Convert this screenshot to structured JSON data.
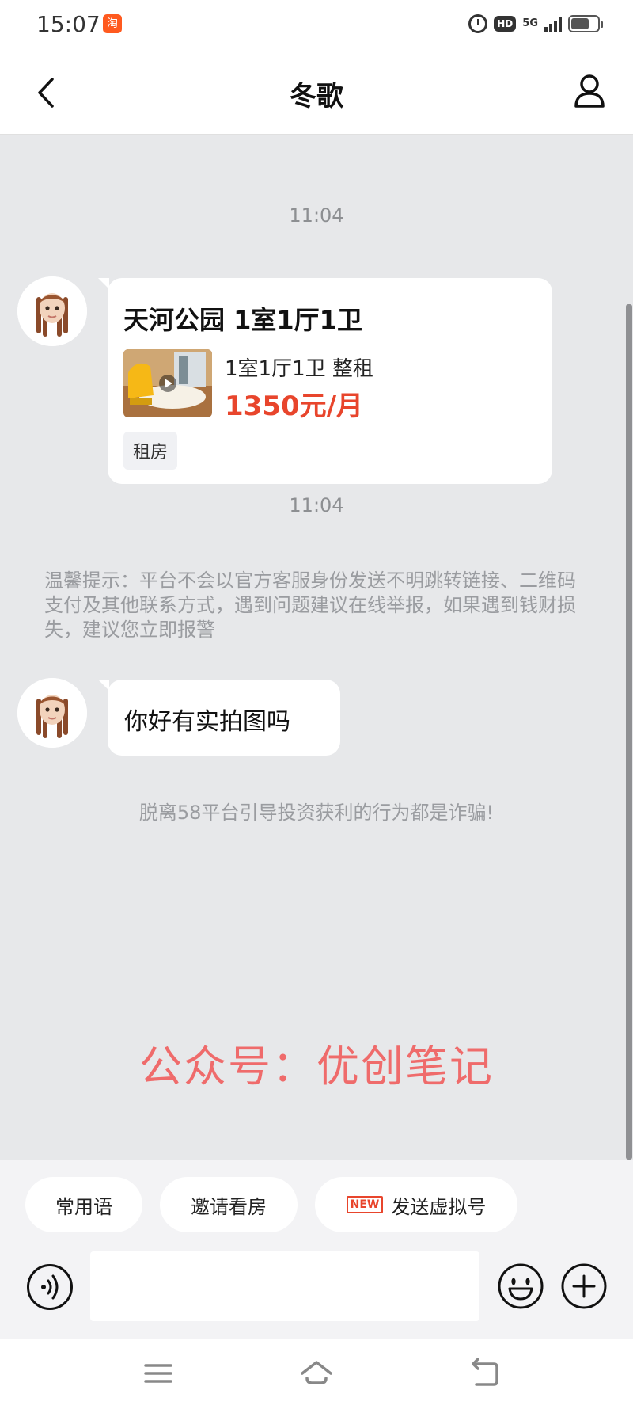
{
  "status_bar": {
    "time": "15:07",
    "app_icon": "taobao-icon",
    "hd": "HD",
    "network": "5G"
  },
  "header": {
    "title": "冬歌"
  },
  "chat": {
    "timestamps": [
      "11:04",
      "11:04"
    ],
    "listing_card": {
      "title": "天河公园 1室1厅1卫",
      "subtitle": "1室1厅1卫 整租",
      "price": "1350元/月",
      "tag": "租房"
    },
    "notice": "温馨提示：平台不会以官方客服身份发送不明跳转链接、二维码支付及其他联系方式，遇到问题建议在线举报，如果遇到钱财损失，建议您立即报警",
    "message": "你好有实拍图吗",
    "warning": "脱离58平台引导投资获利的行为都是诈骗!",
    "watermark": "公众号：优创笔记"
  },
  "quick_replies": [
    {
      "label": "常用语"
    },
    {
      "label": "邀请看房"
    },
    {
      "label": "发送虚拟号",
      "badge": "NEW"
    }
  ],
  "input": {
    "placeholder": ""
  },
  "colors": {
    "price": "#e8452c",
    "watermark": "#ef6b6b",
    "chat_background": "#e7e8ea",
    "badge": "#e8452c"
  }
}
